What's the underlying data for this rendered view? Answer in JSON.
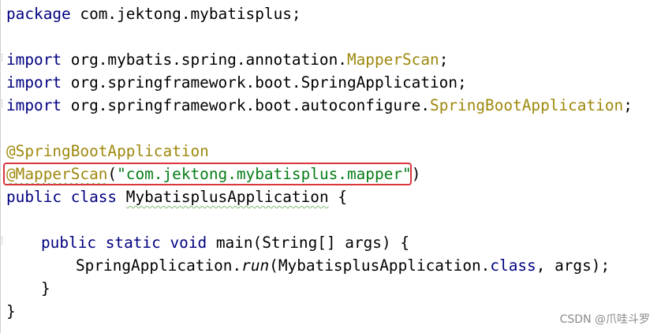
{
  "code": {
    "line1": {
      "kw": "package",
      "rest": " com.jektong.mybatisplus;"
    },
    "line2": {
      "kw": "import",
      "pkg": " org.mybatis.spring.annotation.",
      "cls": "MapperScan",
      "end": ";"
    },
    "line3": {
      "kw": "import",
      "pkg": " org.springframework.boot.SpringApplication;"
    },
    "line4": {
      "kw": "import",
      "pkg": " org.springframework.boot.autoconfigure.",
      "cls": "SpringBootApplication",
      "end": ";"
    },
    "line5": {
      "ann": "@SpringBootApplication"
    },
    "line6": {
      "ann": "@MapperScan",
      "open": "(",
      "str": "\"com.jektong.mybatisplus.mapper\"",
      "close": ")"
    },
    "line7": {
      "kw1": "public",
      "kw2": "class",
      "name": "MybatisplusApplication",
      "brace": " {"
    },
    "line8": {
      "kw1": "public",
      "kw2": "static",
      "kw3": "void",
      "rest": " main(String[] args) {"
    },
    "line9": {
      "pre": "SpringApplication.",
      "method": "run",
      "mid": "(MybatisplusApplication.",
      "kw": "class",
      "end": ", args);"
    },
    "line10": {
      "text": "}"
    },
    "line11": {
      "text": "}"
    }
  },
  "highlight": {
    "color": "#d9363e"
  },
  "watermark": "CSDN @爪哇斗罗"
}
